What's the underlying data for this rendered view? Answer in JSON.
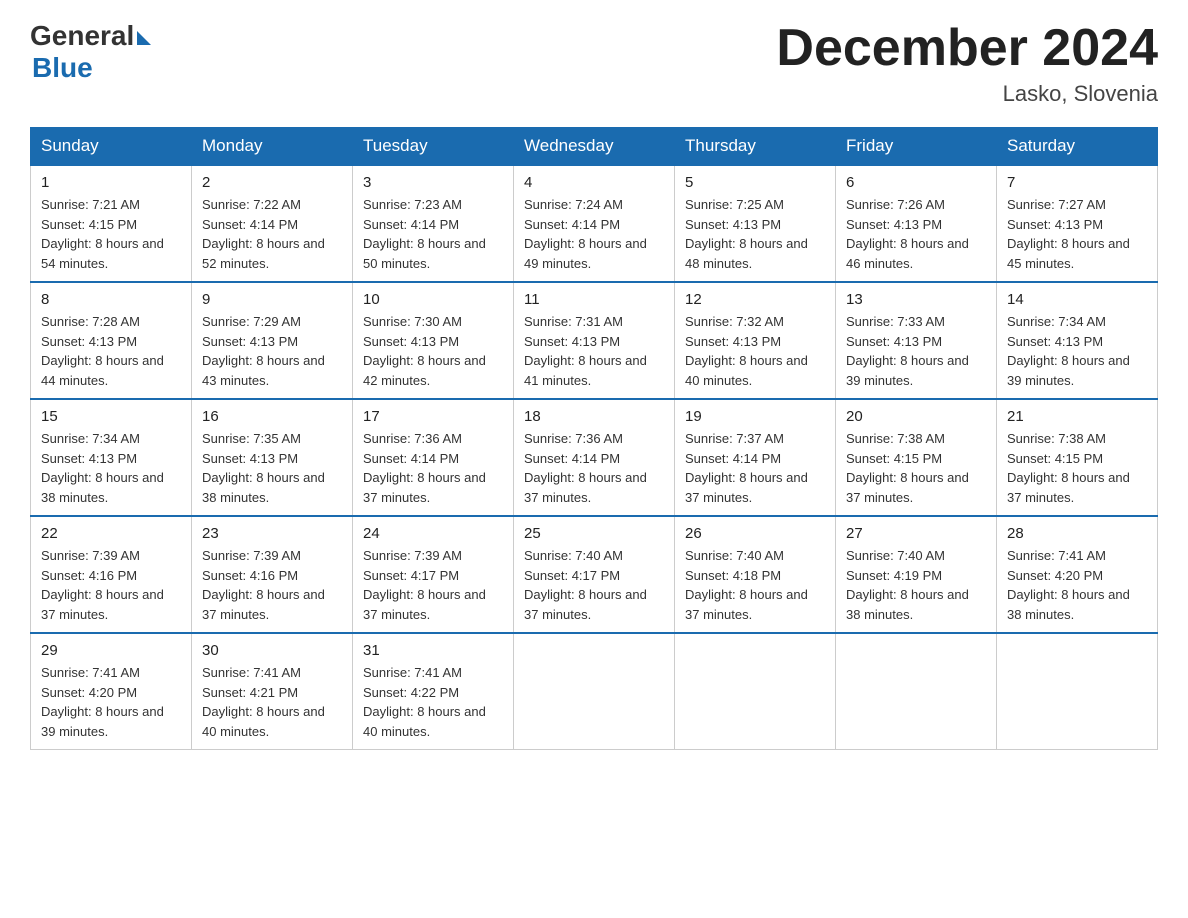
{
  "logo": {
    "general": "General",
    "blue": "Blue"
  },
  "title": "December 2024",
  "subtitle": "Lasko, Slovenia",
  "days_of_week": [
    "Sunday",
    "Monday",
    "Tuesday",
    "Wednesday",
    "Thursday",
    "Friday",
    "Saturday"
  ],
  "weeks": [
    [
      {
        "day": "1",
        "sunrise": "7:21 AM",
        "sunset": "4:15 PM",
        "daylight": "8 hours and 54 minutes."
      },
      {
        "day": "2",
        "sunrise": "7:22 AM",
        "sunset": "4:14 PM",
        "daylight": "8 hours and 52 minutes."
      },
      {
        "day": "3",
        "sunrise": "7:23 AM",
        "sunset": "4:14 PM",
        "daylight": "8 hours and 50 minutes."
      },
      {
        "day": "4",
        "sunrise": "7:24 AM",
        "sunset": "4:14 PM",
        "daylight": "8 hours and 49 minutes."
      },
      {
        "day": "5",
        "sunrise": "7:25 AM",
        "sunset": "4:13 PM",
        "daylight": "8 hours and 48 minutes."
      },
      {
        "day": "6",
        "sunrise": "7:26 AM",
        "sunset": "4:13 PM",
        "daylight": "8 hours and 46 minutes."
      },
      {
        "day": "7",
        "sunrise": "7:27 AM",
        "sunset": "4:13 PM",
        "daylight": "8 hours and 45 minutes."
      }
    ],
    [
      {
        "day": "8",
        "sunrise": "7:28 AM",
        "sunset": "4:13 PM",
        "daylight": "8 hours and 44 minutes."
      },
      {
        "day": "9",
        "sunrise": "7:29 AM",
        "sunset": "4:13 PM",
        "daylight": "8 hours and 43 minutes."
      },
      {
        "day": "10",
        "sunrise": "7:30 AM",
        "sunset": "4:13 PM",
        "daylight": "8 hours and 42 minutes."
      },
      {
        "day": "11",
        "sunrise": "7:31 AM",
        "sunset": "4:13 PM",
        "daylight": "8 hours and 41 minutes."
      },
      {
        "day": "12",
        "sunrise": "7:32 AM",
        "sunset": "4:13 PM",
        "daylight": "8 hours and 40 minutes."
      },
      {
        "day": "13",
        "sunrise": "7:33 AM",
        "sunset": "4:13 PM",
        "daylight": "8 hours and 39 minutes."
      },
      {
        "day": "14",
        "sunrise": "7:34 AM",
        "sunset": "4:13 PM",
        "daylight": "8 hours and 39 minutes."
      }
    ],
    [
      {
        "day": "15",
        "sunrise": "7:34 AM",
        "sunset": "4:13 PM",
        "daylight": "8 hours and 38 minutes."
      },
      {
        "day": "16",
        "sunrise": "7:35 AM",
        "sunset": "4:13 PM",
        "daylight": "8 hours and 38 minutes."
      },
      {
        "day": "17",
        "sunrise": "7:36 AM",
        "sunset": "4:14 PM",
        "daylight": "8 hours and 37 minutes."
      },
      {
        "day": "18",
        "sunrise": "7:36 AM",
        "sunset": "4:14 PM",
        "daylight": "8 hours and 37 minutes."
      },
      {
        "day": "19",
        "sunrise": "7:37 AM",
        "sunset": "4:14 PM",
        "daylight": "8 hours and 37 minutes."
      },
      {
        "day": "20",
        "sunrise": "7:38 AM",
        "sunset": "4:15 PM",
        "daylight": "8 hours and 37 minutes."
      },
      {
        "day": "21",
        "sunrise": "7:38 AM",
        "sunset": "4:15 PM",
        "daylight": "8 hours and 37 minutes."
      }
    ],
    [
      {
        "day": "22",
        "sunrise": "7:39 AM",
        "sunset": "4:16 PM",
        "daylight": "8 hours and 37 minutes."
      },
      {
        "day": "23",
        "sunrise": "7:39 AM",
        "sunset": "4:16 PM",
        "daylight": "8 hours and 37 minutes."
      },
      {
        "day": "24",
        "sunrise": "7:39 AM",
        "sunset": "4:17 PM",
        "daylight": "8 hours and 37 minutes."
      },
      {
        "day": "25",
        "sunrise": "7:40 AM",
        "sunset": "4:17 PM",
        "daylight": "8 hours and 37 minutes."
      },
      {
        "day": "26",
        "sunrise": "7:40 AM",
        "sunset": "4:18 PM",
        "daylight": "8 hours and 37 minutes."
      },
      {
        "day": "27",
        "sunrise": "7:40 AM",
        "sunset": "4:19 PM",
        "daylight": "8 hours and 38 minutes."
      },
      {
        "day": "28",
        "sunrise": "7:41 AM",
        "sunset": "4:20 PM",
        "daylight": "8 hours and 38 minutes."
      }
    ],
    [
      {
        "day": "29",
        "sunrise": "7:41 AM",
        "sunset": "4:20 PM",
        "daylight": "8 hours and 39 minutes."
      },
      {
        "day": "30",
        "sunrise": "7:41 AM",
        "sunset": "4:21 PM",
        "daylight": "8 hours and 40 minutes."
      },
      {
        "day": "31",
        "sunrise": "7:41 AM",
        "sunset": "4:22 PM",
        "daylight": "8 hours and 40 minutes."
      },
      null,
      null,
      null,
      null
    ]
  ],
  "labels": {
    "sunrise": "Sunrise:",
    "sunset": "Sunset:",
    "daylight": "Daylight:"
  }
}
